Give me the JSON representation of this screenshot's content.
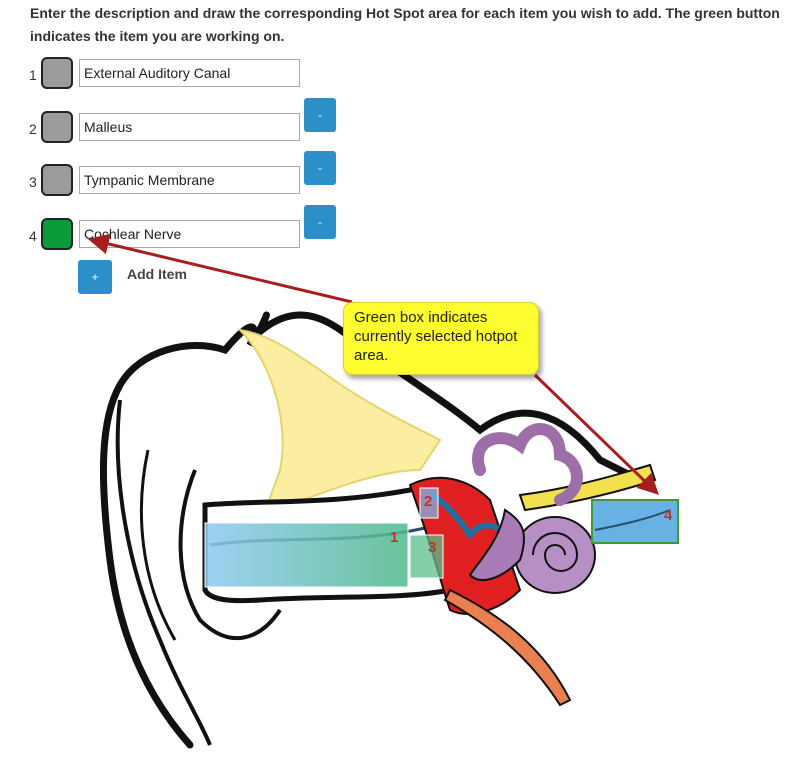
{
  "instructions": "Enter the description and draw the corresponding Hot Spot area for each item you wish to add. The green button indicates the item you are working on.",
  "items": [
    {
      "number": "1",
      "value": "External Auditory Canal",
      "selected": false,
      "has_remove": false
    },
    {
      "number": "2",
      "value": "Malleus",
      "selected": false,
      "has_remove": true
    },
    {
      "number": "3",
      "value": "Tympanic Membrane",
      "selected": false,
      "has_remove": true
    },
    {
      "number": "4",
      "value": "Cochlear Nerve",
      "selected": true,
      "has_remove": true
    }
  ],
  "remove_button_label": "-",
  "add_button_label": "+",
  "add_item_label": "Add Item",
  "callout_text": "Green box indicates currently selected hotpot area.",
  "hotspots": [
    {
      "label": "1"
    },
    {
      "label": "2"
    },
    {
      "label": "3"
    },
    {
      "label": "4"
    }
  ],
  "colors": {
    "selected_box": "#0a9a3a",
    "unselected_box": "#9b9b9b",
    "button_blue": "#2d8fc8",
    "callout_yellow": "#fdfc2f",
    "arrow_red": "#a81e1e",
    "hotspot_label_red": "#c0312b"
  },
  "icons": {
    "anatomy_image": "ear-anatomy-illustration",
    "arrows": "callout-arrow"
  }
}
